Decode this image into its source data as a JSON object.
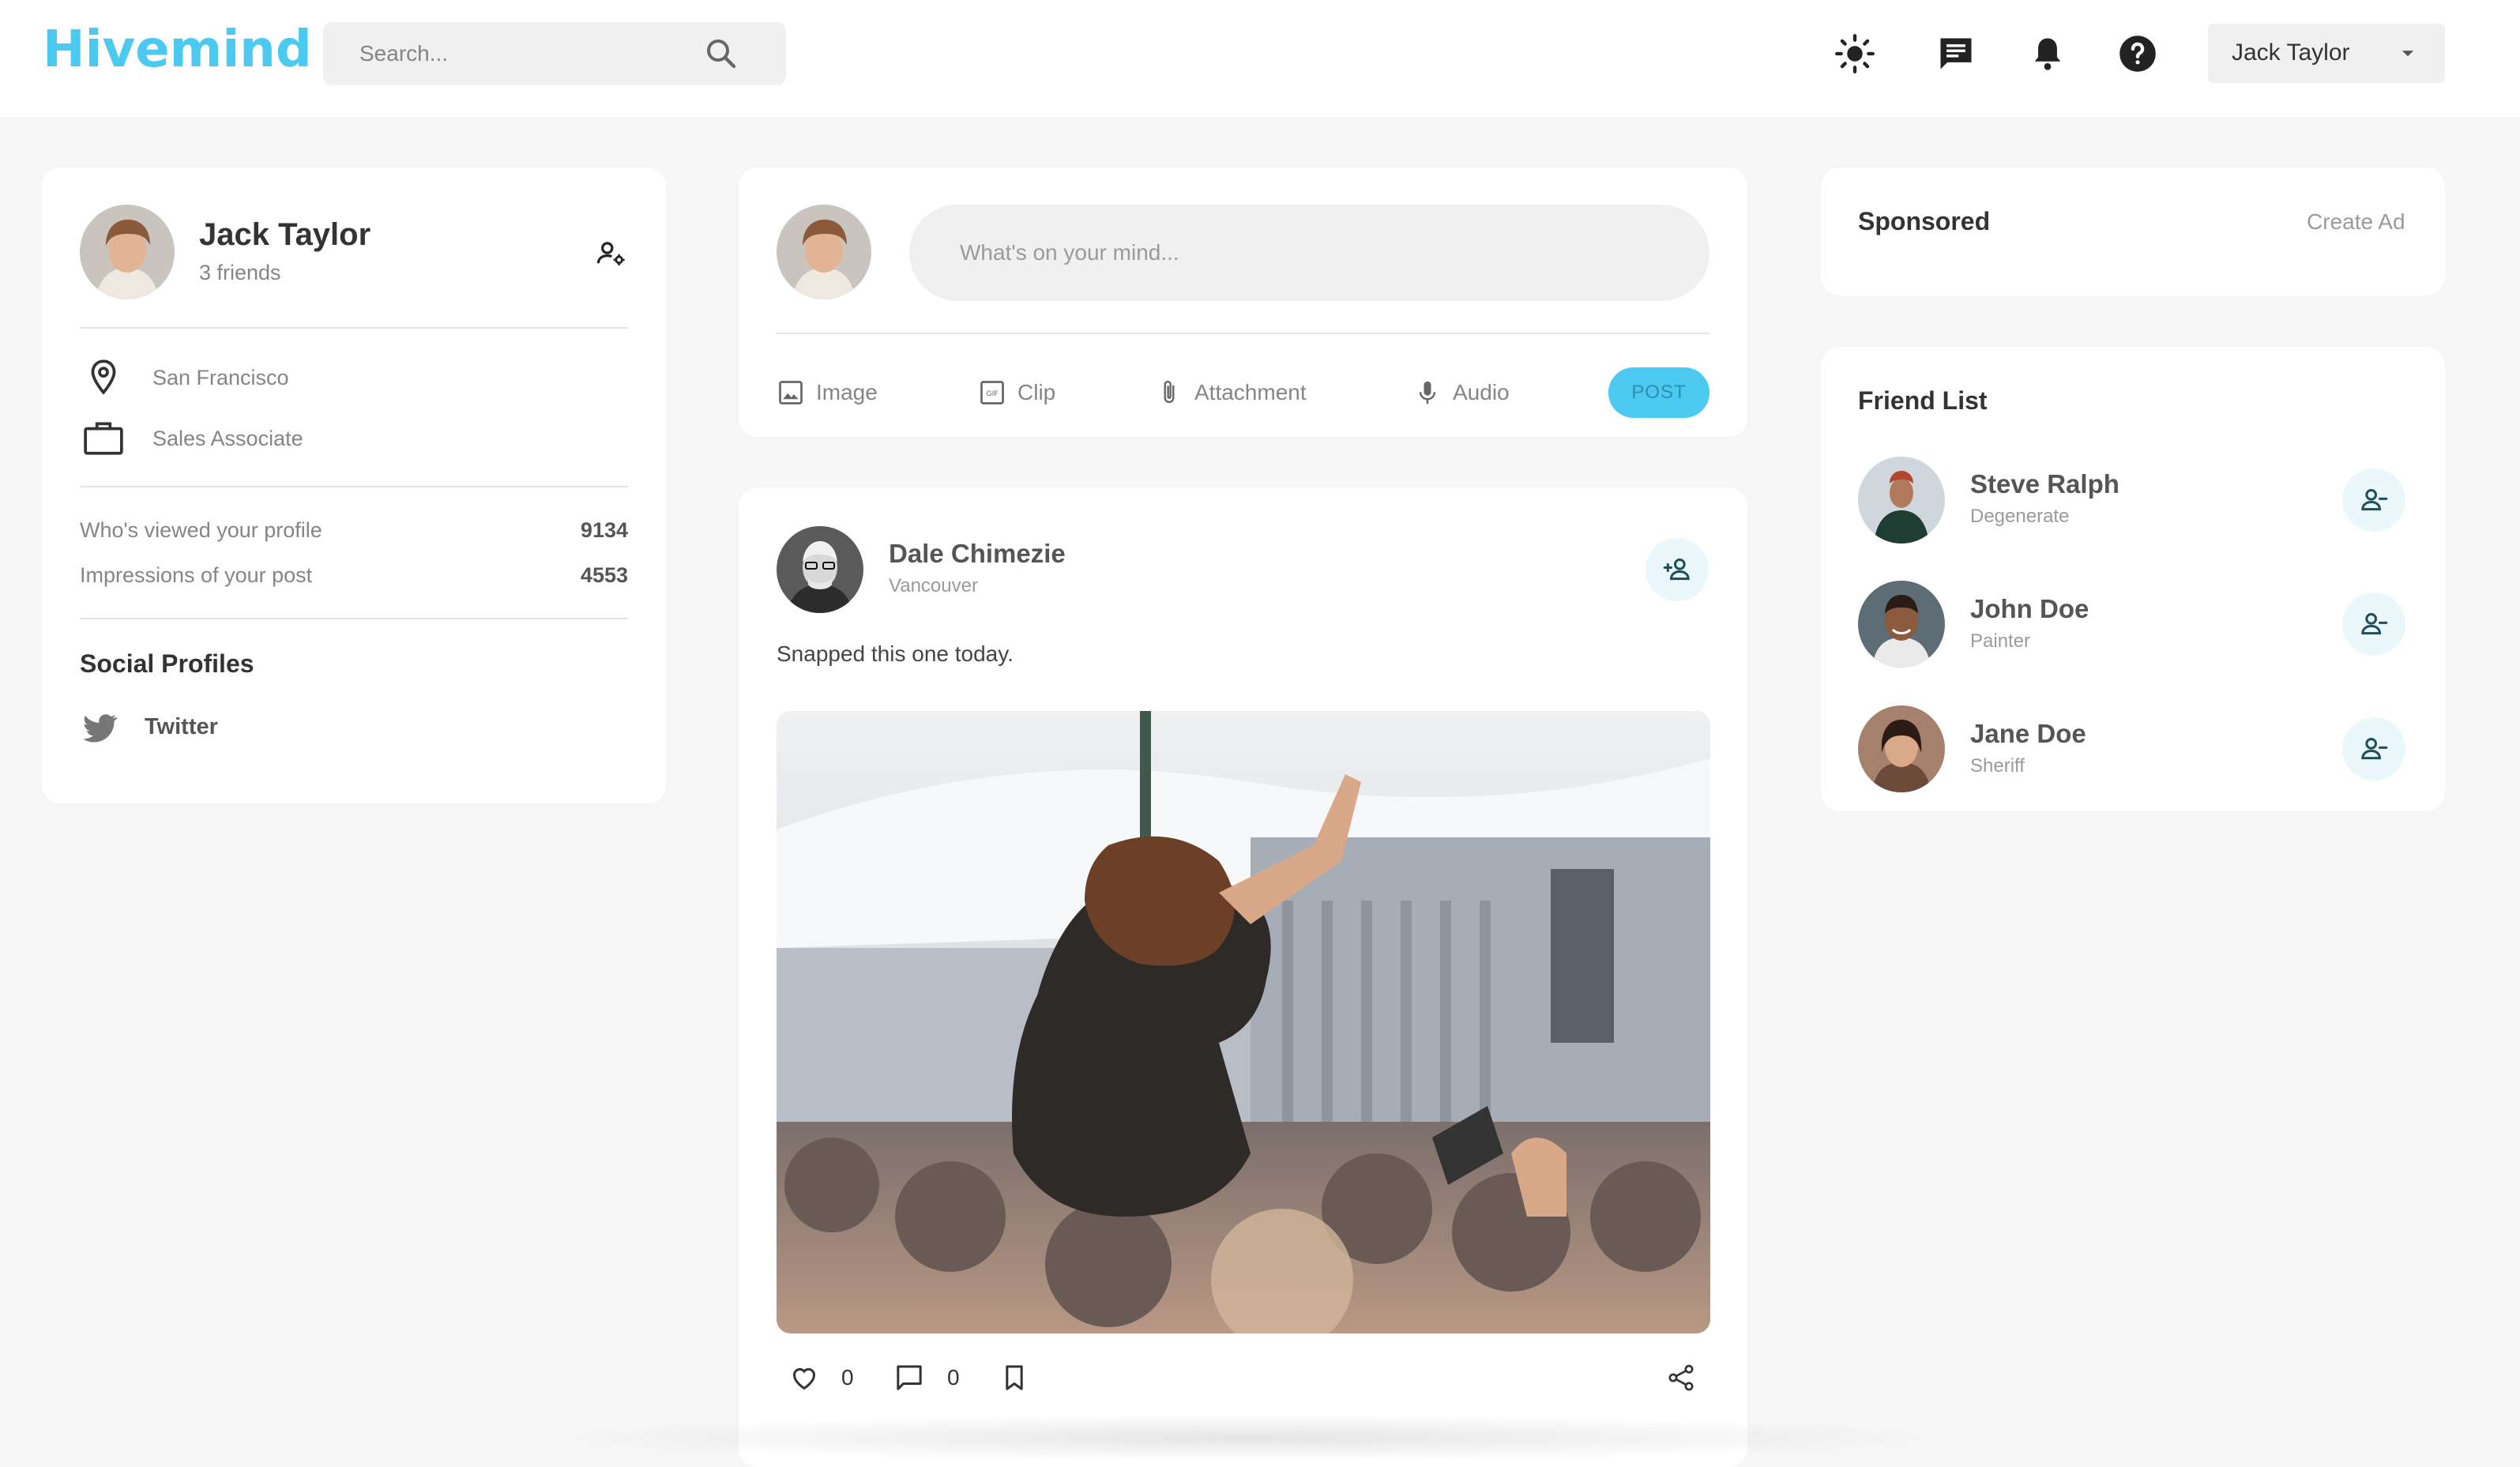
{
  "app": {
    "logo": "Hivemind"
  },
  "search": {
    "placeholder": "Search..."
  },
  "header": {
    "user_name": "Jack Taylor"
  },
  "profile": {
    "name": "Jack Taylor",
    "friends": "3 friends",
    "location": "San Francisco",
    "occupation": "Sales Associate",
    "stats": [
      {
        "label": "Who's viewed your profile",
        "value": "9134"
      },
      {
        "label": "Impressions of your post",
        "value": "4553"
      }
    ],
    "social_title": "Social Profiles",
    "social": [
      {
        "label": "Twitter",
        "icon": "twitter-icon"
      }
    ]
  },
  "composer": {
    "placeholder": "What's on your mind...",
    "tools": [
      {
        "label": "Image",
        "icon": "image-icon"
      },
      {
        "label": "Clip",
        "icon": "gif-icon"
      },
      {
        "label": "Attachment",
        "icon": "paperclip-icon"
      },
      {
        "label": "Audio",
        "icon": "mic-icon"
      }
    ],
    "post_label": "POST"
  },
  "post": {
    "author": "Dale Chimezie",
    "location": "Vancouver",
    "text": "Snapped this one today.",
    "likes": "0",
    "comments": "0"
  },
  "sponsored": {
    "title": "Sponsored",
    "create_ad": "Create Ad"
  },
  "friends": {
    "title": "Friend List",
    "items": [
      {
        "name": "Steve Ralph",
        "role": "Degenerate"
      },
      {
        "name": "John Doe",
        "role": "Painter"
      },
      {
        "name": "Jane Doe",
        "role": "Sheriff"
      }
    ]
  },
  "colors": {
    "accent": "#4cc9f0",
    "background": "#f6f6f6",
    "card": "#ffffff"
  }
}
